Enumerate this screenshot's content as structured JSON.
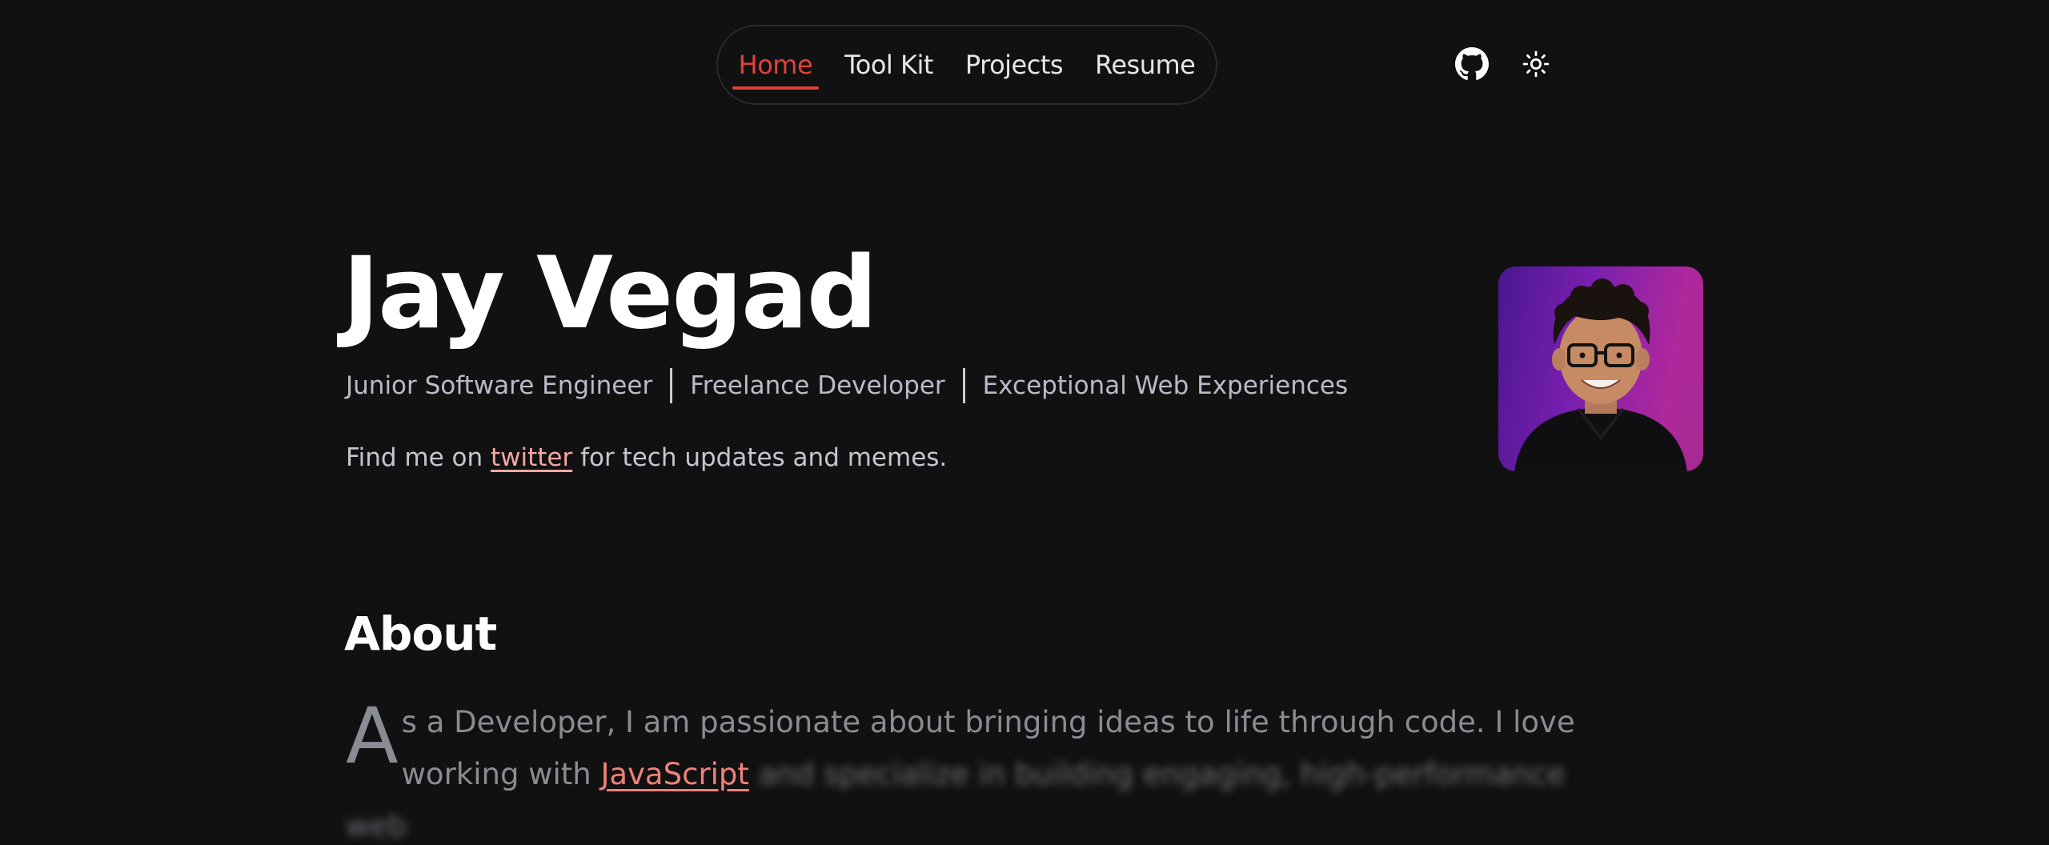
{
  "nav": {
    "items": [
      {
        "label": "Home",
        "active": true
      },
      {
        "label": "Tool Kit",
        "active": false
      },
      {
        "label": "Projects",
        "active": false
      },
      {
        "label": "Resume",
        "active": false
      }
    ],
    "accent_color": "#e0413a",
    "icons": [
      "github-icon",
      "sun-icon"
    ]
  },
  "hero": {
    "name": "Jay Vegad",
    "roles": [
      "Junior Software Engineer",
      "Freelance Developer",
      "Exceptional Web Experiences"
    ],
    "find_prefix": "Find me on ",
    "find_link": "twitter",
    "find_suffix": " for tech updates and memes."
  },
  "about": {
    "title": "About",
    "dropcap": "A",
    "text_1": "s a Developer, I am passionate about bringing ideas to life through code. I love working with ",
    "link": "JavaScript",
    "text_2": " and specialize in building engaging, high-performance web"
  }
}
